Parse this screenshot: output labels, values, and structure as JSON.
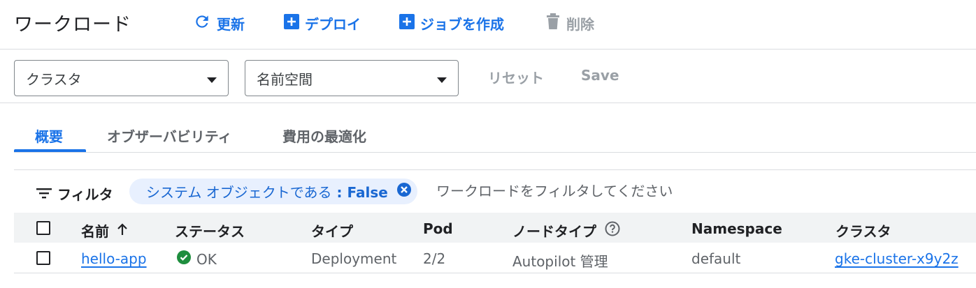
{
  "header": {
    "title": "ワークロード",
    "refresh_label": "更新",
    "deploy_label": "デプロイ",
    "create_job_label": "ジョブを作成",
    "delete_label": "削除"
  },
  "selectors": {
    "cluster_label": "クラスタ",
    "namespace_label": "名前空間",
    "reset_label": "リセット",
    "save_label": "Save"
  },
  "tabs": [
    {
      "label": "概要",
      "active": true
    },
    {
      "label": "オブザーバビリティ",
      "active": false
    },
    {
      "label": "費用の最適化",
      "active": false
    }
  ],
  "filter": {
    "label": "フィルタ",
    "chip_key": "システム オブジェクトである",
    "chip_sep": " : ",
    "chip_value": "False",
    "placeholder": "ワークロードをフィルタしてください"
  },
  "table": {
    "columns": [
      "名前",
      "ステータス",
      "タイプ",
      "Pod",
      "ノードタイプ",
      "Namespace",
      "クラスタ"
    ],
    "rows": [
      {
        "name": "hello-app",
        "status": "OK",
        "type": "Deployment",
        "pods": "2/2",
        "node_type": "Autopilot 管理",
        "namespace": "default",
        "cluster": "gke-cluster-x9y2z"
      }
    ]
  },
  "colors": {
    "accent": "#1a73e8",
    "chip_bg": "#e8f0fe",
    "header_bg": "#f1f3f4",
    "ok_green": "#1e8e3e",
    "disabled": "#9aa0a6"
  }
}
